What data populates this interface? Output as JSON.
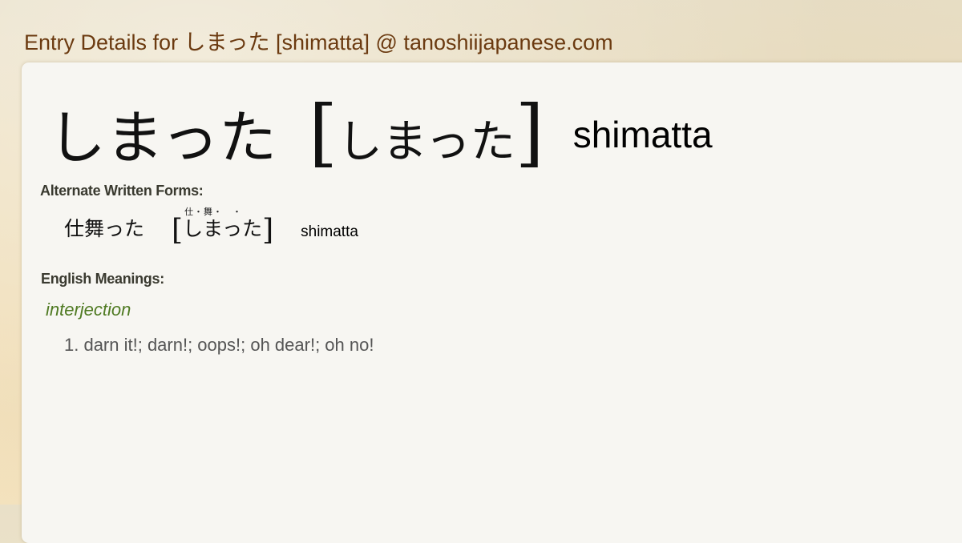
{
  "page": {
    "heading": "Entry Details for しまった [shimatta] @ tanoshiijapanese.com"
  },
  "entry": {
    "headword": "しまった",
    "bracket_open": "[",
    "reading": "しまった",
    "bracket_close": "]",
    "romaji": "shimatta"
  },
  "alternate_forms": {
    "label": "Alternate Written Forms:",
    "items": [
      {
        "written": "仕舞った",
        "bracket_open": "[",
        "reading": "しまった",
        "ruby": "仕・舞・　・",
        "bracket_close": "]",
        "romaji": "shimatta"
      }
    ]
  },
  "english_meanings": {
    "label": "English Meanings:",
    "part_of_speech": "interjection",
    "meanings": [
      {
        "text": "1. darn it!; darn!; oops!; oh dear!; oh no!"
      }
    ]
  }
}
